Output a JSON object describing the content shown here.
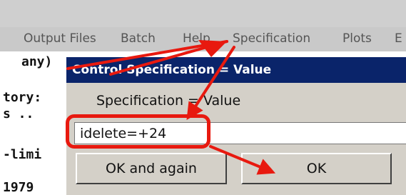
{
  "menubar": {
    "items": [
      "Output Files",
      "Batch",
      "Help",
      "Specification",
      "Plots",
      "E"
    ]
  },
  "console": {
    "lines": [
      "any)",
      "tory:",
      "s ..",
      "-limi",
      "1979"
    ]
  },
  "dialog": {
    "title": "Control Specification = Value",
    "prompt": "Specification = Value",
    "input_value": "idelete=+24",
    "ok_again_label": "OK and again",
    "ok_label": "OK"
  },
  "colors": {
    "annotation": "#e8190f",
    "title_bar": "#0a246a",
    "dialog_bg": "#d4d0c8"
  }
}
